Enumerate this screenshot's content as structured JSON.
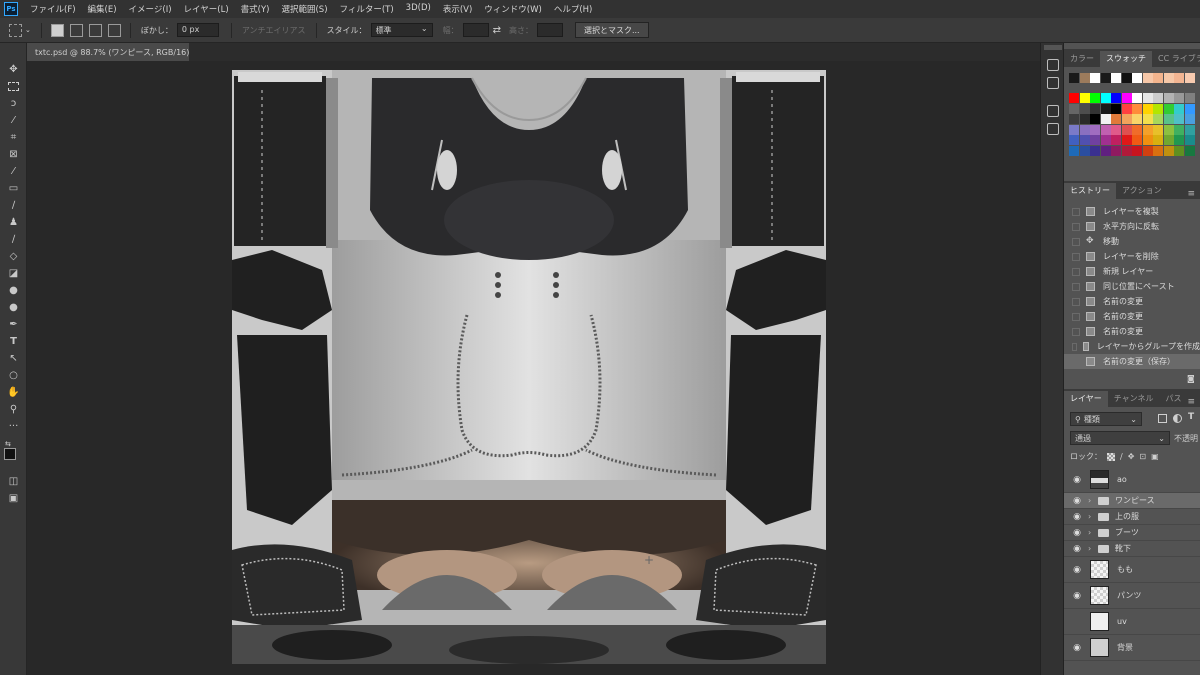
{
  "menu": {
    "items": [
      "ファイル(F)",
      "編集(E)",
      "イメージ(I)",
      "レイヤー(L)",
      "書式(Y)",
      "選択範囲(S)",
      "フィルター(T)",
      "3D(D)",
      "表示(V)",
      "ウィンドウ(W)",
      "ヘルプ(H)"
    ]
  },
  "options": {
    "feather_label": "ぼかし：",
    "feather_value": "0 px",
    "antialias_label": "アンチエイリアス",
    "style_label": "スタイル：",
    "style_value": "標準",
    "width_label": "幅：",
    "height_label": "高さ：",
    "select_mask_button": "選択とマスク..."
  },
  "document": {
    "tab_title": "txtc.psd @ 88.7% (ワンピース, RGB/16)",
    "close_glyph": "×"
  },
  "color_panel": {
    "tabs": [
      "カラー",
      "スウォッチ",
      "CC ライブラリ"
    ],
    "active_tab": "スウォッチ",
    "swatch_rows": [
      [
        "#1a1a1a",
        "#9c7b5c",
        "#ffffff",
        "#1a1a1a",
        "#ffffff",
        "#111111",
        "#ffffff",
        "#f6c7a8",
        "#f3b48d",
        "#f6c8a8",
        "#f3b592",
        "#f8cbb0"
      ],
      [
        "#ff0000",
        "#ffff00",
        "#00ff00",
        "#00ffff",
        "#0000ff",
        "#ff00ff",
        "#ffffff",
        "#e6e6e6",
        "#cccccc",
        "#b3b3b3",
        "#999999",
        "#808080"
      ],
      [
        "#666666",
        "#4d4d4d",
        "#333333",
        "#1a1a1a",
        "#000000",
        "#ff4040",
        "#ff8c3a",
        "#ffd400",
        "#b3e600",
        "#33cc33",
        "#33cccc",
        "#3399ff"
      ],
      [
        "#3c3c3c",
        "#2a2a2a",
        "#000000",
        "#f2f2f2",
        "#e07a3a",
        "#f2a35c",
        "#f9d469",
        "#f4e04d",
        "#a9d85a",
        "#59c28a",
        "#4fc0c7",
        "#4a9fe0"
      ],
      [
        "#7a7ac8",
        "#8a70c0",
        "#a06cc0",
        "#c060b0",
        "#e05a8a",
        "#e05050",
        "#f06c2a",
        "#f4a12a",
        "#e8c02a",
        "#8cc040",
        "#40b060",
        "#30a0a0"
      ],
      [
        "#4060c0",
        "#5050b0",
        "#7040a0",
        "#a03090",
        "#c02060",
        "#e01818",
        "#f05a14",
        "#f09010",
        "#d8b010",
        "#70a830",
        "#209850",
        "#1a8c8c"
      ],
      [
        "#1e6ab8",
        "#2a4ea0",
        "#3a3090",
        "#602080",
        "#901a60",
        "#b01a3a",
        "#c8141e",
        "#d04010",
        "#d87010",
        "#c09010",
        "#609020",
        "#187840"
      ]
    ]
  },
  "history_panel": {
    "tabs": [
      "ヒストリー",
      "アクション"
    ],
    "active_tab": "ヒストリー",
    "items": [
      {
        "label": "レイヤーを複製",
        "icon": "document",
        "selected": false
      },
      {
        "label": "水平方向に反転",
        "icon": "document",
        "selected": false
      },
      {
        "label": "移動",
        "icon": "move",
        "selected": false
      },
      {
        "label": "レイヤーを削除",
        "icon": "document",
        "selected": false
      },
      {
        "label": "新規 レイヤー",
        "icon": "document",
        "selected": false
      },
      {
        "label": "同じ位置にペースト",
        "icon": "document",
        "selected": false
      },
      {
        "label": "名前の変更",
        "icon": "document",
        "selected": false
      },
      {
        "label": "名前の変更",
        "icon": "document",
        "selected": false
      },
      {
        "label": "名前の変更",
        "icon": "document",
        "selected": false
      },
      {
        "label": "レイヤーからグループを作成",
        "icon": "document",
        "selected": false
      },
      {
        "label": "名前の変更（保存）",
        "icon": "document",
        "selected": true
      }
    ]
  },
  "layers_panel": {
    "tabs": [
      "レイヤー",
      "チャンネル",
      "パス"
    ],
    "active_tab": "レイヤー",
    "filter_value": "種類",
    "blend_mode": "通過",
    "opacity_label": "不透明",
    "lock_label": "ロック：",
    "layers": [
      {
        "name": "ao",
        "kind": "thumb",
        "visible": true
      },
      {
        "name": "ワンピース",
        "kind": "folder",
        "visible": true,
        "selected": true
      },
      {
        "name": "上の服",
        "kind": "folder",
        "visible": true
      },
      {
        "name": "ブーツ",
        "kind": "folder",
        "visible": true
      },
      {
        "name": "靴下",
        "kind": "folder",
        "visible": true
      },
      {
        "name": "もも",
        "kind": "checker",
        "visible": true
      },
      {
        "name": "パンツ",
        "kind": "checker",
        "visible": true
      },
      {
        "name": "uv",
        "kind": "uv",
        "visible": false
      },
      {
        "name": "背景",
        "kind": "gray",
        "visible": true
      }
    ]
  }
}
